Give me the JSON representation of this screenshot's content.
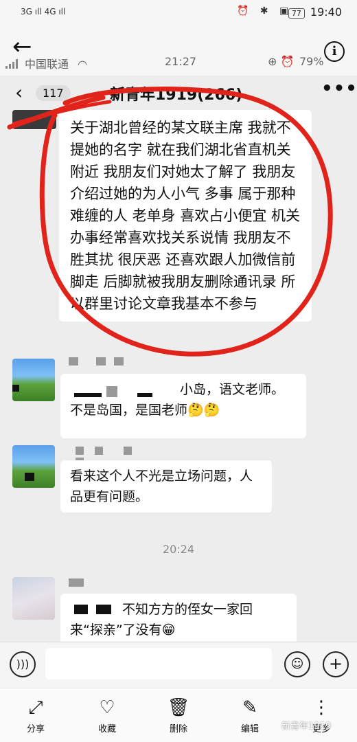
{
  "outer_status": {
    "signal_left": "3G ıll 4G ıll",
    "icons": "⏰ ✱ ▣",
    "battery": "77",
    "time": "19:40"
  },
  "viewer": {
    "back_icon": "arrow-left",
    "info_icon": "i"
  },
  "inner_status": {
    "carrier": "中国联通",
    "time": "21:27",
    "battery": "79%"
  },
  "chat": {
    "unread_count": "117",
    "title": "新青年1919(266)",
    "more": "•••"
  },
  "messages": [
    {
      "text": "关于湖北曾经的某文联主席 我就不提她的名字 就在我们湖北省直机关附近 我朋友们对她太了解了 我朋友介绍过她的为人小气 多事 属于那种难缠的人 老单身 喜欢占小便宜 机关办事经常喜欢找关系说情 我朋友不胜其扰 很厌恶 还喜欢跟人加微信前脚走 后脚就被我朋友删除通讯录 所以群里讨论文章我基本不参与"
    },
    {
      "text_line1": "小岛，语文老师。",
      "text_line2": "不是岛国，是国老师🤔🤔"
    },
    {
      "text": "看来这个人不光是立场问题，人品更有问题。"
    },
    {
      "text_line1": "不知方方的侄女一家回",
      "text_line2": "来“探亲”了没有😁"
    }
  ],
  "time_separator": "20:24",
  "input": {
    "placeholder": ""
  },
  "toolbar": {
    "share": "分享",
    "favorite": "收藏",
    "delete": "删除",
    "edit": "编辑",
    "more": "更多"
  },
  "watermark": "新青年1919",
  "colors": {
    "annotation_red": "#e0241b",
    "chat_bg": "#ededed",
    "bubble": "#ffffff"
  }
}
